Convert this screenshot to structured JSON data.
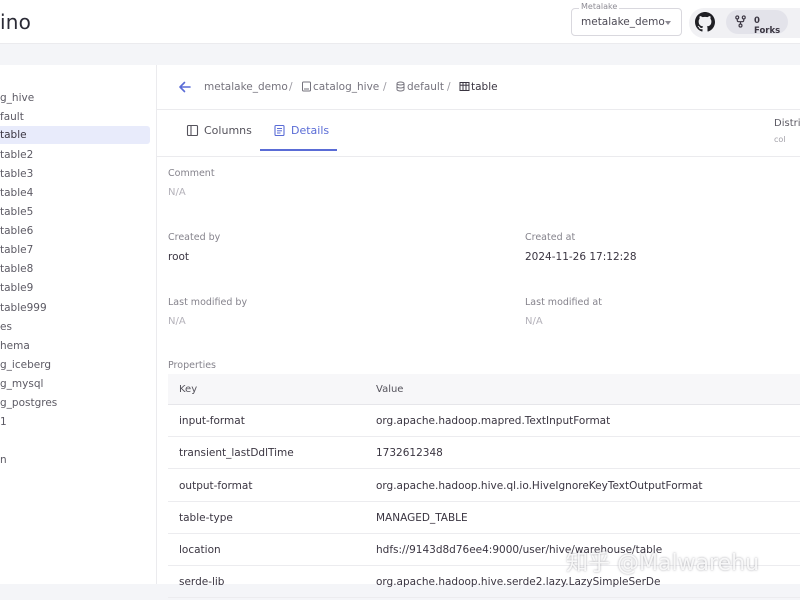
{
  "header": {
    "brand": "ino",
    "metalake_label": "Metalake",
    "metalake_value": "metalake_demo",
    "forks_label": "0 Forks"
  },
  "sidebar": {
    "items": [
      {
        "label": "g_hive",
        "selected": false
      },
      {
        "label": "fault",
        "selected": false
      },
      {
        "label": " table",
        "selected": true
      },
      {
        "label": " table2",
        "selected": false
      },
      {
        "label": " table3",
        "selected": false
      },
      {
        "label": " table4",
        "selected": false
      },
      {
        "label": " table5",
        "selected": false
      },
      {
        "label": " table6",
        "selected": false
      },
      {
        "label": " table7",
        "selected": false
      },
      {
        "label": " table8",
        "selected": false
      },
      {
        "label": " table9",
        "selected": false
      },
      {
        "label": " table999",
        "selected": false
      },
      {
        "label": "es",
        "selected": false
      },
      {
        "label": "hema",
        "selected": false
      },
      {
        "label": "g_iceberg",
        "selected": false
      },
      {
        "label": "g_mysql",
        "selected": false
      },
      {
        "label": "g_postgres",
        "selected": false
      },
      {
        "label": "1",
        "selected": false
      },
      {
        "label": "",
        "selected": false
      },
      {
        "label": "n",
        "selected": false
      }
    ]
  },
  "breadcrumb": {
    "metalake": "metalake_demo",
    "catalog": "catalog_hive",
    "schema": "default",
    "table": "table",
    "separator": "/"
  },
  "tabs": {
    "columns": "Columns",
    "details": "Details",
    "active": "details"
  },
  "distribution": {
    "label": "Distri",
    "sub": "col"
  },
  "details": {
    "comment_label": "Comment",
    "comment_value": "N/A",
    "created_by_label": "Created by",
    "created_by_value": "root",
    "created_at_label": "Created at",
    "created_at_value": "2024-11-26 17:12:28",
    "last_modified_by_label": "Last modified by",
    "last_modified_by_value": "N/A",
    "last_modified_at_label": "Last modified at",
    "last_modified_at_value": "N/A",
    "properties_label": "Properties"
  },
  "properties": {
    "headers": {
      "key": "Key",
      "value": "Value"
    },
    "rows": [
      {
        "key": "input-format",
        "value": "org.apache.hadoop.mapred.TextInputFormat"
      },
      {
        "key": "transient_lastDdlTime",
        "value": "1732612348"
      },
      {
        "key": "output-format",
        "value": "org.apache.hadoop.hive.ql.io.HiveIgnoreKeyTextOutputFormat"
      },
      {
        "key": "table-type",
        "value": "MANAGED_TABLE"
      },
      {
        "key": "location",
        "value": "hdfs://9143d8d76ee4:9000/user/hive/warehouse/table"
      },
      {
        "key": "serde-lib",
        "value": "org.apache.hadoop.hive.serde2.lazy.LazySimpleSerDe"
      }
    ]
  },
  "watermark": "知乎 @Malwarehu",
  "colors": {
    "accent": "#5a6cd6",
    "selected_bg": "#e8ebfb"
  }
}
